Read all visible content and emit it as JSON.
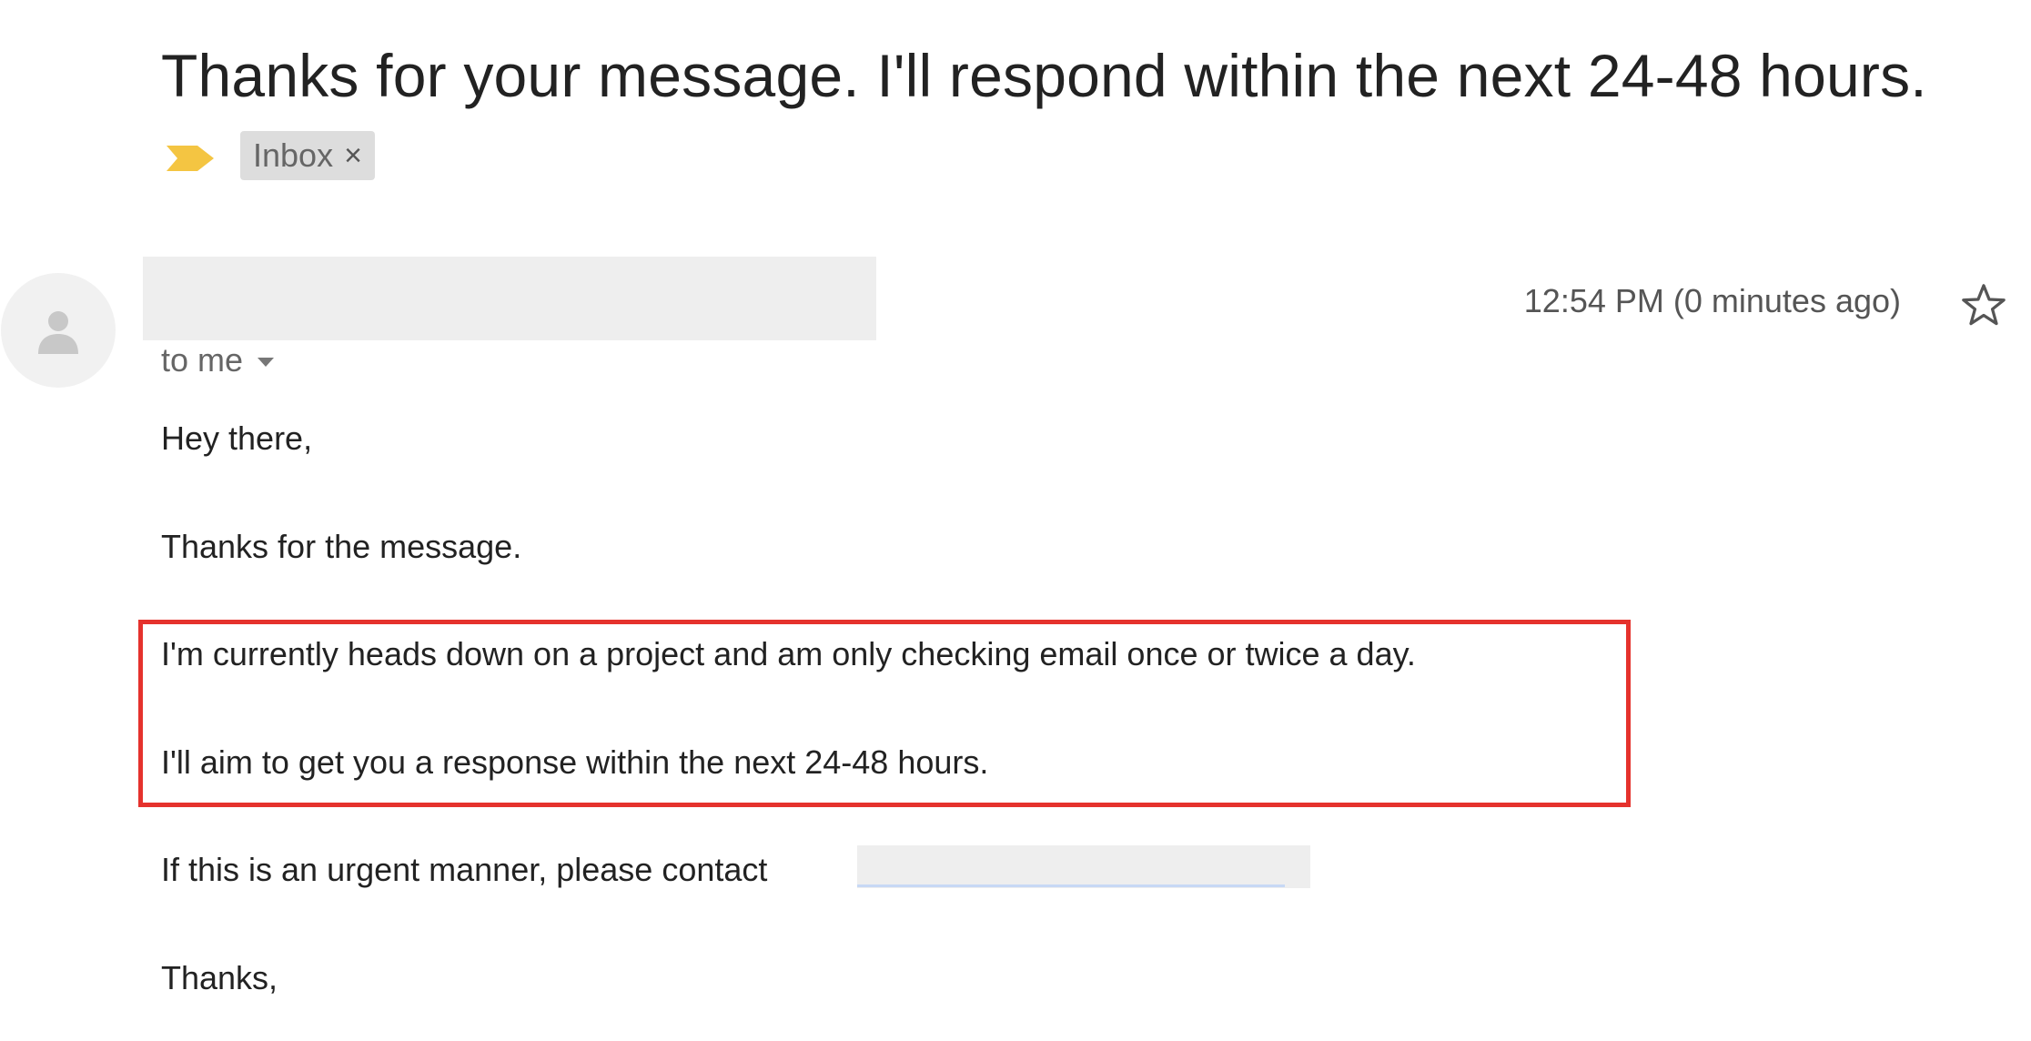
{
  "email": {
    "subject": "Thanks for your message. I'll respond within the next 24-48 hours.",
    "label": "Inbox",
    "label_remove_glyph": "×",
    "recipient": "to me",
    "timestamp": "12:54 PM (0 minutes ago)",
    "body": {
      "greeting": "Hey there,",
      "line1": "Thanks for the message.",
      "line2": "I'm currently heads down on a project and am only checking email once or twice a day.",
      "line3": "I'll aim to get you a response within the next 24-48 hours.",
      "line4": "If this is an urgent manner, please contact",
      "signoff": "Thanks,"
    }
  },
  "icons": {
    "importance": "importance-marker-icon",
    "avatar": "default-avatar-icon",
    "star": "star-outline-icon",
    "caret": "caret-down-icon"
  },
  "colors": {
    "importance": "#f4c542",
    "highlight_border": "#e5322d",
    "chip_background": "#dddddd",
    "redaction": "#eeeeee"
  }
}
